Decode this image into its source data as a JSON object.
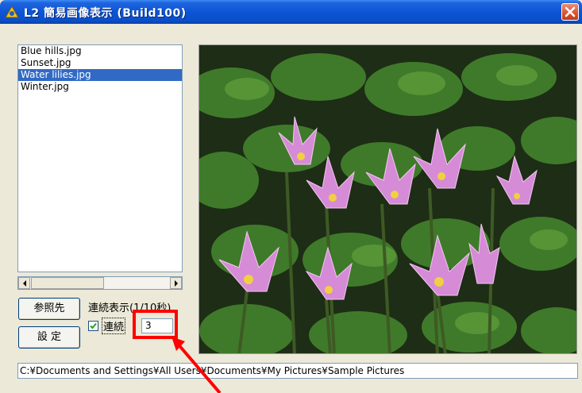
{
  "window": {
    "title": "L2 簡易画像表示 (Build100)"
  },
  "files": {
    "items": [
      {
        "label": "Blue hills.jpg",
        "selected": false
      },
      {
        "label": "Sunset.jpg",
        "selected": false
      },
      {
        "label": "Water lilies.jpg",
        "selected": true
      },
      {
        "label": "Winter.jpg",
        "selected": false
      }
    ]
  },
  "controls": {
    "browse_label": "参照先",
    "settings_label": "設 定",
    "continuous_display_label": "連続表示(1/10秒)",
    "continuous_checkbox_label": "連続",
    "continuous_checked": true,
    "interval_value": "3"
  },
  "path": {
    "value": "C:¥Documents and Settings¥All Users¥Documents¥My Pictures¥Sample Pictures"
  },
  "icons": {
    "app": "app-icon",
    "close": "close-icon",
    "scroll_left": "chevron-left-icon",
    "scroll_right": "chevron-right-icon",
    "check": "check-icon"
  },
  "colors": {
    "titlebar": "#0a4ec8",
    "selection": "#316ac5",
    "highlight": "#ff0000",
    "window_bg": "#ece9d8"
  }
}
